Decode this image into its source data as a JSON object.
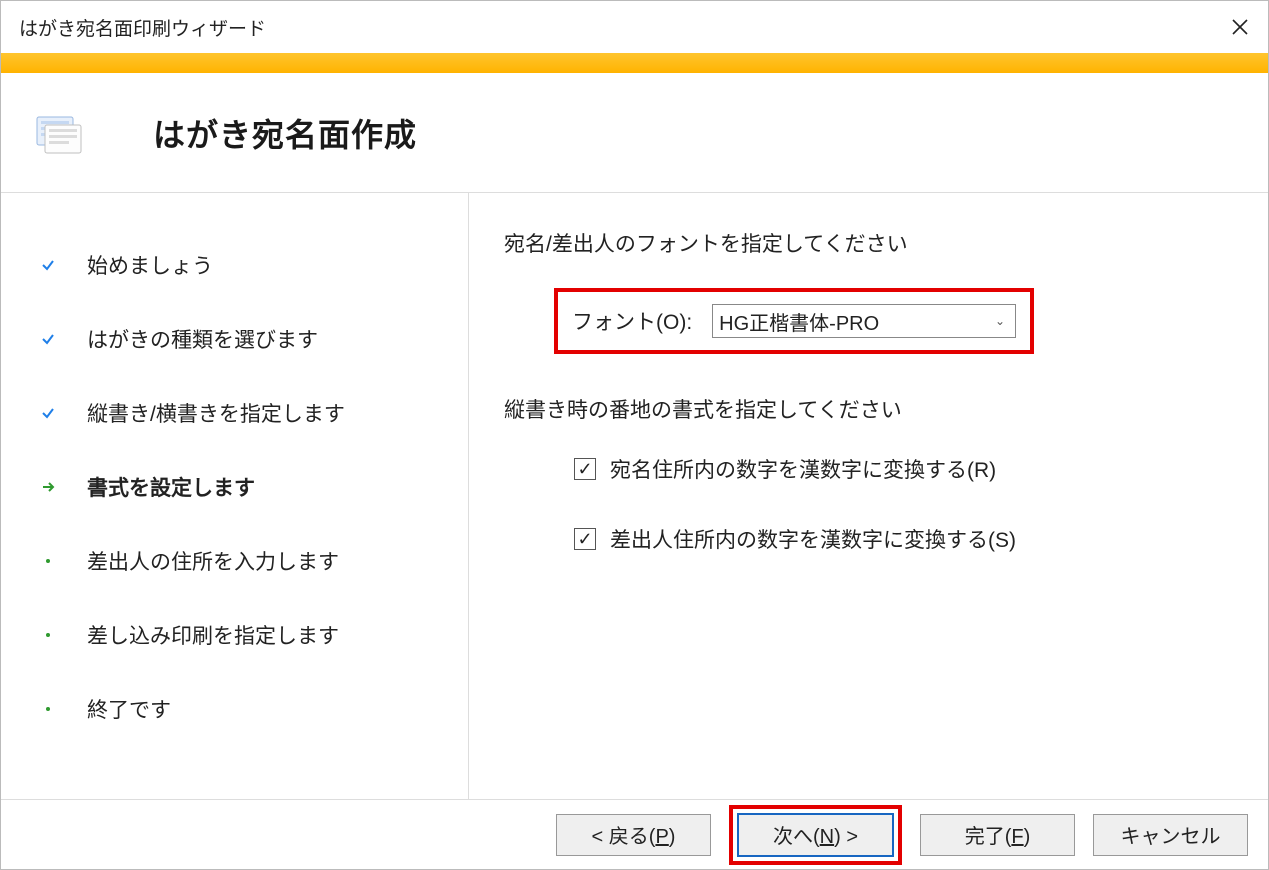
{
  "window": {
    "title": "はがき宛名面印刷ウィザード"
  },
  "header": {
    "title": "はがき宛名面作成"
  },
  "steps": [
    {
      "label": "始めましょう",
      "state": "done"
    },
    {
      "label": "はがきの種類を選びます",
      "state": "done"
    },
    {
      "label": "縦書き/横書きを指定します",
      "state": "done"
    },
    {
      "label": "書式を設定します",
      "state": "current"
    },
    {
      "label": "差出人の住所を入力します",
      "state": "pending"
    },
    {
      "label": "差し込み印刷を指定します",
      "state": "pending"
    },
    {
      "label": "終了です",
      "state": "pending"
    }
  ],
  "content": {
    "font_section_heading": "宛名/差出人のフォントを指定してください",
    "font_label": "フォント(O):",
    "font_value": "HG正楷書体-PRO",
    "format_section_heading": "縦書き時の番地の書式を指定してください",
    "cb1_label": "宛名住所内の数字を漢数字に変換する(R)",
    "cb1_checked": true,
    "cb2_label": "差出人住所内の数字を漢数字に変換する(S)",
    "cb2_checked": true
  },
  "footer": {
    "back_prefix": "< 戻る(",
    "back_key": "P",
    "back_suffix": ")",
    "next_prefix": "次へ(",
    "next_key": "N",
    "next_suffix": ") >",
    "finish_prefix": "完了(",
    "finish_key": "F",
    "finish_suffix": ")",
    "cancel": "キャンセル"
  }
}
